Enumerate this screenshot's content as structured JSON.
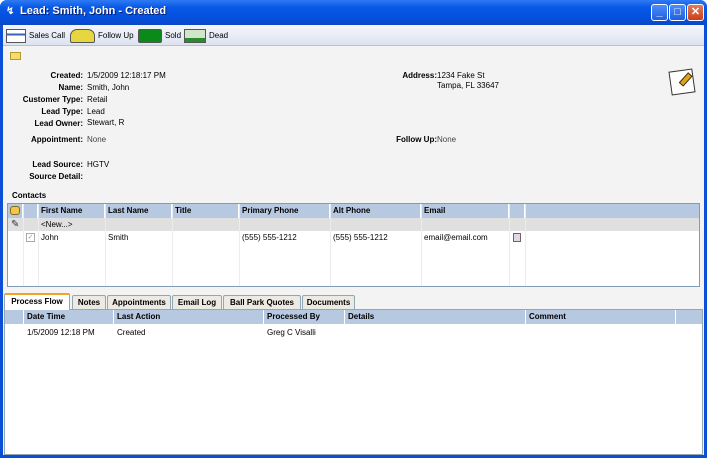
{
  "window": {
    "title": "Lead: Smith, John - Created",
    "min": "_",
    "max": "□",
    "close": "✕"
  },
  "toolbar": {
    "items": [
      {
        "label": "Sales Call",
        "icon": "calendar-icon"
      },
      {
        "label": "Follow Up",
        "icon": "phone-icon"
      },
      {
        "label": "Sold",
        "icon": "folder-icon"
      },
      {
        "label": "Dead",
        "icon": "computer-icon"
      }
    ]
  },
  "lead": {
    "created_label": "Created:",
    "created": "1/5/2009 12:18:17 PM",
    "name_label": "Name:",
    "name": "Smith, John",
    "customer_type_label": "Customer Type:",
    "customer_type": "Retail",
    "lead_type_label": "Lead Type:",
    "lead_type": "Lead",
    "lead_owner_label": "Lead Owner:",
    "lead_owner": "Stewart, R",
    "appointment_label": "Appointment:",
    "appointment": "None",
    "follow_up_label": "Follow Up:",
    "follow_up": "None",
    "lead_source_label": "Lead Source:",
    "lead_source": "HGTV",
    "source_detail_label": "Source Detail:",
    "source_detail": "",
    "address_label": "Address:",
    "address_line1": "1234 Fake St",
    "address_line2": "Tampa, FL 33647"
  },
  "contacts": {
    "title": "Contacts",
    "columns": [
      "First Name",
      "Last Name",
      "Title",
      "Primary Phone",
      "Alt Phone",
      "Email"
    ],
    "new_row": "<New...>",
    "rows": [
      {
        "first": "John",
        "last": "Smith",
        "title": "",
        "primary": "(555) 555-1212",
        "alt": "(555) 555-1212",
        "email": "email@email.com"
      }
    ]
  },
  "tabs": [
    "Process Flow",
    "Notes",
    "Appointments",
    "Email Log",
    "Ball Park Quotes",
    "Documents"
  ],
  "active_tab": "Process Flow",
  "process": {
    "columns": [
      "Date Time",
      "Last Action",
      "Processed By",
      "Details",
      "Comment"
    ],
    "rows": [
      {
        "datetime": "1/5/2009 12:18 PM",
        "action": "Created",
        "by": "Greg C Visalli",
        "details": "",
        "comment": ""
      }
    ]
  }
}
